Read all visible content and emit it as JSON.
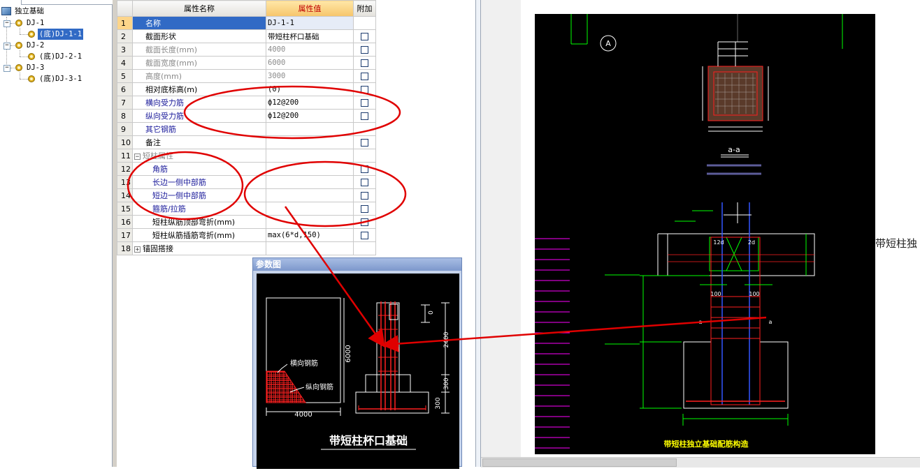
{
  "tree": {
    "root": "独立基础",
    "items": [
      {
        "label": "DJ-1",
        "child": "(底)DJ-1-1",
        "selected": true
      },
      {
        "label": "DJ-2",
        "child": "(底)DJ-2-1",
        "selected": false
      },
      {
        "label": "DJ-3",
        "child": "(底)DJ-3-1",
        "selected": false
      }
    ]
  },
  "grid": {
    "headers": {
      "name": "属性名称",
      "value": "属性值",
      "extra": "附加"
    },
    "rows": [
      {
        "num": "1",
        "name": "名称",
        "value": "DJ-1-1",
        "style": "selected",
        "check": false
      },
      {
        "num": "2",
        "name": "截面形状",
        "value": "带短柱杯口基础",
        "style": "normal",
        "check": true
      },
      {
        "num": "3",
        "name": "截面长度(mm)",
        "value": "4000",
        "style": "gray",
        "check": true
      },
      {
        "num": "4",
        "name": "截面宽度(mm)",
        "value": "6000",
        "style": "gray",
        "check": true
      },
      {
        "num": "5",
        "name": "高度(mm)",
        "value": "3000",
        "style": "gray",
        "check": true
      },
      {
        "num": "6",
        "name": "相对底标高(m)",
        "value": "(0)",
        "style": "normal",
        "check": true
      },
      {
        "num": "7",
        "name": "横向受力筋",
        "value": "ф12@200",
        "style": "blue",
        "check": true
      },
      {
        "num": "8",
        "name": "纵向受力筋",
        "value": "ф12@200",
        "style": "blue",
        "check": true
      },
      {
        "num": "9",
        "name": "其它钢筋",
        "value": "",
        "style": "blue",
        "check": false
      },
      {
        "num": "10",
        "name": "备注",
        "value": "",
        "style": "normal",
        "check": true
      },
      {
        "num": "11",
        "name": "短柱属性",
        "value": "",
        "style": "group-collapse",
        "check": false
      },
      {
        "num": "12",
        "name": "角筋",
        "value": "",
        "style": "blue-indent",
        "check": true
      },
      {
        "num": "13",
        "name": "长边一侧中部筋",
        "value": "",
        "style": "blue-indent",
        "check": true
      },
      {
        "num": "14",
        "name": "短边一侧中部筋",
        "value": "",
        "style": "blue-indent",
        "check": true
      },
      {
        "num": "15",
        "name": "箍筋/拉筋",
        "value": "",
        "style": "blue-indent",
        "check": true
      },
      {
        "num": "16",
        "name": "短柱纵筋顶部弯折(mm)",
        "value": "",
        "style": "indent",
        "check": true
      },
      {
        "num": "17",
        "name": "短柱纵筋插筋弯折(mm)",
        "value": "max(6*d,150)",
        "style": "indent",
        "check": true
      },
      {
        "num": "18",
        "name": "锚固搭接",
        "value": "",
        "style": "group-expand",
        "check": false
      }
    ]
  },
  "param_window": {
    "title": "参数图",
    "caption": "带短柱杯口基础",
    "lbl_heng": "横向钢筋",
    "lbl_zong": "纵向钢筋",
    "dim_6000": "6000",
    "dim_4000": "4000",
    "dim_2400": "2400",
    "dim_300a": "300",
    "dim_300b": "300",
    "dim_0": "0"
  },
  "cad": {
    "axis_label": "A",
    "section_label": "a-a",
    "dim_100a": "100",
    "dim_100b": "100",
    "dim_12d": "12d",
    "dim_2d": "2d",
    "dim_a1": "a",
    "dim_a2": "a",
    "bottom_title": "带短柱独立基础配筋构造"
  },
  "side_label": "带短柱独",
  "colors": {
    "selection": "#316ac5",
    "header_value": "#c00000",
    "annotation_red": "#e00000",
    "cad_yellow": "#ffff00",
    "cad_green": "#00ff00",
    "cad_red": "#ff2020",
    "cad_magenta": "#ff00ff"
  }
}
